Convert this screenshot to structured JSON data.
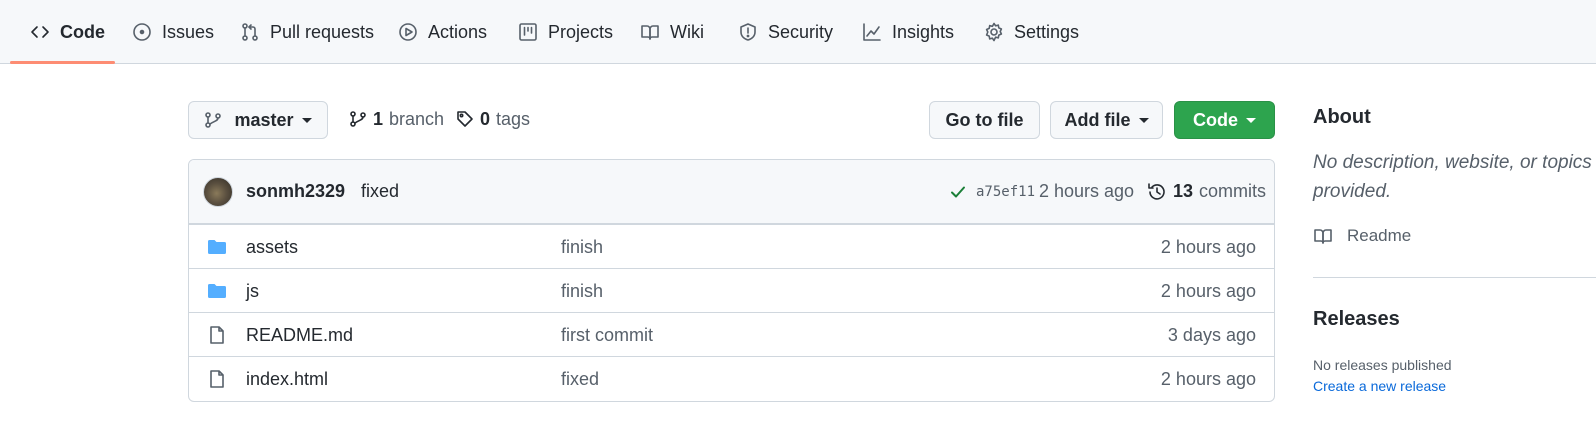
{
  "nav": {
    "tabs": [
      {
        "label": "Code",
        "icon": "code-icon",
        "active": true
      },
      {
        "label": "Issues",
        "icon": "issue-opened-icon"
      },
      {
        "label": "Pull requests",
        "icon": "git-pull-request-icon"
      },
      {
        "label": "Actions",
        "icon": "play-icon"
      },
      {
        "label": "Projects",
        "icon": "project-icon"
      },
      {
        "label": "Wiki",
        "icon": "book-icon"
      },
      {
        "label": "Security",
        "icon": "shield-icon"
      },
      {
        "label": "Insights",
        "icon": "graph-icon"
      },
      {
        "label": "Settings",
        "icon": "gear-icon"
      }
    ]
  },
  "toolbar": {
    "branch": "master",
    "branch_count": "1",
    "branch_label": "branch",
    "tag_count": "0",
    "tag_label": "tags",
    "go_to_file": "Go to file",
    "add_file": "Add file",
    "code": "Code"
  },
  "latest_commit": {
    "author": "sonmh2329",
    "message": "fixed",
    "status": "success",
    "sha": "a75ef11",
    "time": "2 hours ago",
    "commit_count": "13",
    "commit_label": "commits"
  },
  "files": [
    {
      "type": "directory",
      "name": "assets",
      "message": "finish",
      "time": "2 hours ago"
    },
    {
      "type": "directory",
      "name": "js",
      "message": "finish",
      "time": "2 hours ago"
    },
    {
      "type": "file",
      "name": "README.md",
      "message": "first commit",
      "time": "3 days ago"
    },
    {
      "type": "file",
      "name": "index.html",
      "message": "fixed",
      "time": "2 hours ago"
    }
  ],
  "sidebar": {
    "about_title": "About",
    "about_description": "No description, website, or topics provided.",
    "readme_label": "Readme",
    "releases_title": "Releases",
    "no_releases": "No releases published",
    "create_release": "Create a new release"
  },
  "colors": {
    "accent_underline": "#fd8c73",
    "primary_button": "#2da44e",
    "folder": "#54aeff",
    "link": "#0969da",
    "success": "#1a7f37"
  }
}
